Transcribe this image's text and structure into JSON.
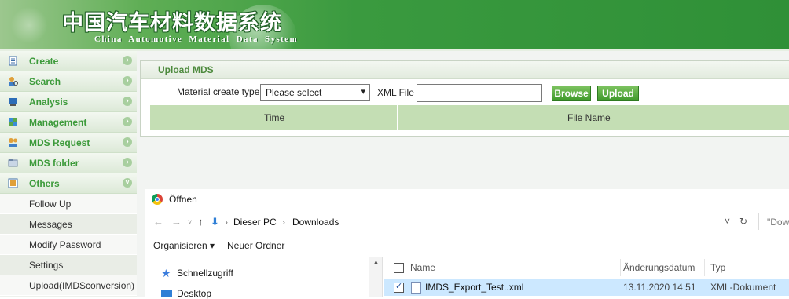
{
  "header": {
    "title_cn": "中国汽车材料数据系统",
    "title_en": "China Automotive Material Data System"
  },
  "sidebar": {
    "items": [
      {
        "label": "Create",
        "icon": "document-icon"
      },
      {
        "label": "Search",
        "icon": "search-people-icon"
      },
      {
        "label": "Analysis",
        "icon": "chart-icon"
      },
      {
        "label": "Management",
        "icon": "management-icon"
      },
      {
        "label": "MDS Request",
        "icon": "request-icon"
      },
      {
        "label": "MDS folder",
        "icon": "folder-icon"
      },
      {
        "label": "Others",
        "icon": "others-icon"
      }
    ],
    "subitems": [
      "Follow Up",
      "Messages",
      "Modify Password",
      "Settings",
      "Upload(IMDSconversion)"
    ]
  },
  "upload": {
    "panel_title": "Upload MDS",
    "type_label": "Material create type",
    "type_value": "Please select",
    "file_label": "XML File",
    "browse_label": "Browse",
    "upload_label": "Upload",
    "col_time": "Time",
    "col_filename": "File Name"
  },
  "dialog": {
    "title": "Öffnen",
    "breadcrumb": [
      "Dieser PC",
      "Downloads"
    ],
    "search_placeholder": "\"Dowr",
    "toolbar": {
      "organize": "Organisieren ▾",
      "new_folder": "Neuer Ordner"
    },
    "left_pane": [
      "Schnellzugriff",
      "Desktop"
    ],
    "columns": {
      "name": "Name",
      "modified": "Änderungsdatum",
      "type": "Typ"
    },
    "file": {
      "name": "IMDS_Export_Test..xml",
      "modified": "13.11.2020 14:51",
      "type": "XML-Dokument"
    }
  },
  "colors": {
    "accent_green": "#3c9a3a",
    "header_green": "#2f9037",
    "selection_blue": "#cce8ff"
  }
}
